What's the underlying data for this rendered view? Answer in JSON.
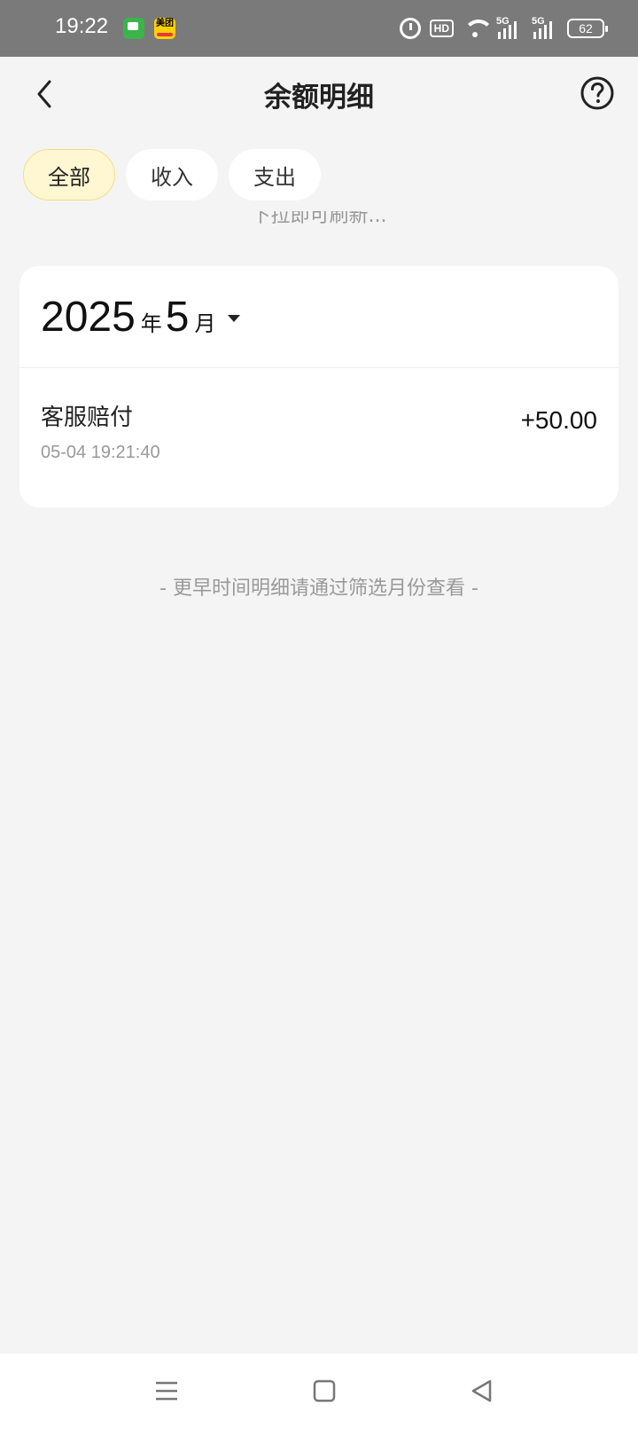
{
  "status_bar": {
    "time": "19:22",
    "app_icons": [
      "messages-icon",
      "meituan-icon"
    ],
    "meituan_label": "美团",
    "hd_label": "HD",
    "signal_label_1": "5G",
    "signal_label_2": "5G",
    "battery": "62"
  },
  "header": {
    "title": "余额明细",
    "back_icon": "chevron-left-icon",
    "help_icon": "question-circle-icon"
  },
  "tabs": [
    {
      "label": "全部",
      "active": true
    },
    {
      "label": "收入",
      "active": false
    },
    {
      "label": "支出",
      "active": false
    }
  ],
  "pull_hint": "下拉即可刷新...",
  "card": {
    "year": "2025",
    "year_unit": "年",
    "month": "5",
    "month_unit": "月",
    "records": [
      {
        "title": "客服赔付",
        "time": "05-04 19:21:40",
        "amount": "+50.00"
      }
    ]
  },
  "footer_note": "- 更早时间明细请通过筛选月份查看 -",
  "colors": {
    "active_tab_bg": "#fff7d1",
    "page_bg": "#f4f4f4",
    "status_bar_bg": "#7a7a7a"
  }
}
